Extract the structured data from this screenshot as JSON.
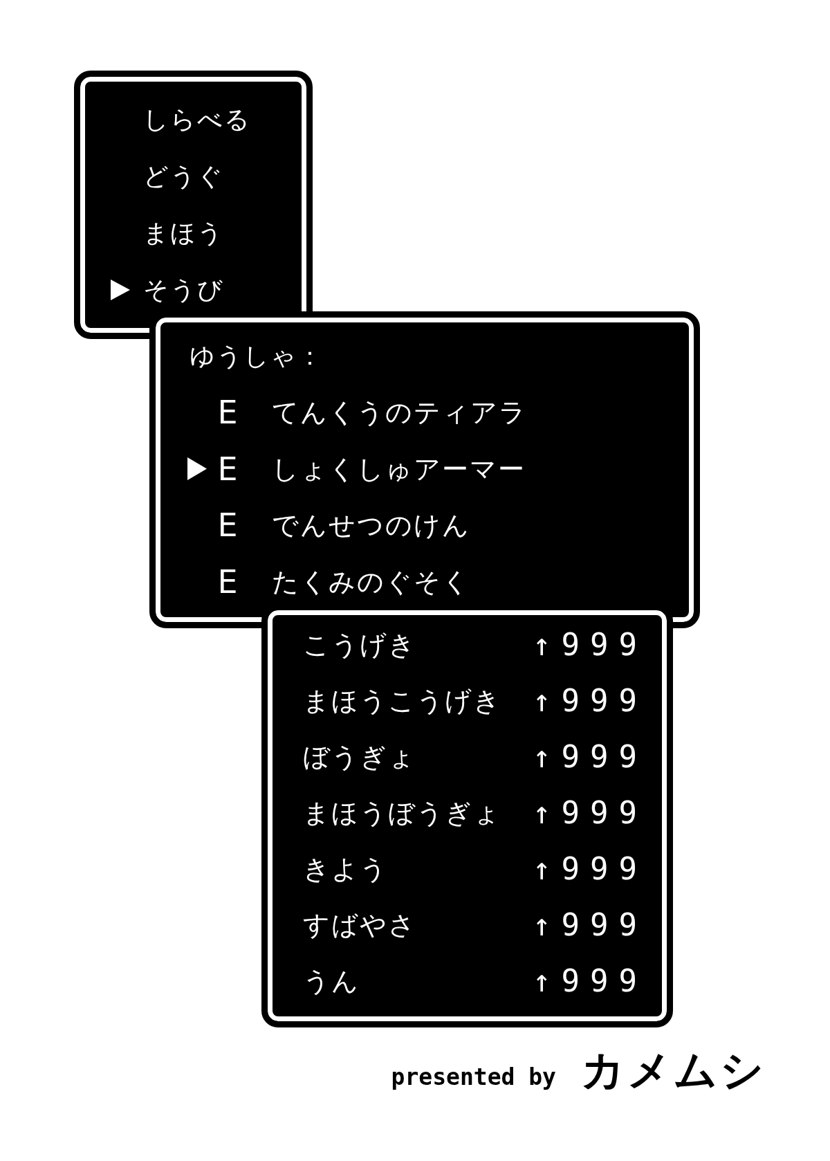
{
  "command_menu": {
    "items": [
      {
        "label": "しらべる",
        "selected": false
      },
      {
        "label": "どうぐ",
        "selected": false
      },
      {
        "label": "まほう",
        "selected": false
      },
      {
        "label": "そうび",
        "selected": true
      }
    ]
  },
  "equipment": {
    "character": "ゆうしゃ：",
    "items": [
      {
        "mark": "E",
        "name": "てんくうのティアラ",
        "selected": false
      },
      {
        "mark": "E",
        "name": "しょくしゅアーマー",
        "selected": true
      },
      {
        "mark": "E",
        "name": "でんせつのけん",
        "selected": false
      },
      {
        "mark": "E",
        "name": "たくみのぐそく",
        "selected": false
      }
    ]
  },
  "stats": {
    "rows": [
      {
        "name": "こうげき",
        "change": "↑999"
      },
      {
        "name": "まほうこうげき",
        "change": "↑999"
      },
      {
        "name": "ぼうぎょ",
        "change": "↑999"
      },
      {
        "name": "まほうぼうぎょ",
        "change": "↑999"
      },
      {
        "name": "きよう",
        "change": "↑999"
      },
      {
        "name": "すばやさ",
        "change": "↑999"
      },
      {
        "name": "うん",
        "change": "↑999"
      }
    ]
  },
  "credit": {
    "prefix": "presented by",
    "author": "カメムシ"
  }
}
